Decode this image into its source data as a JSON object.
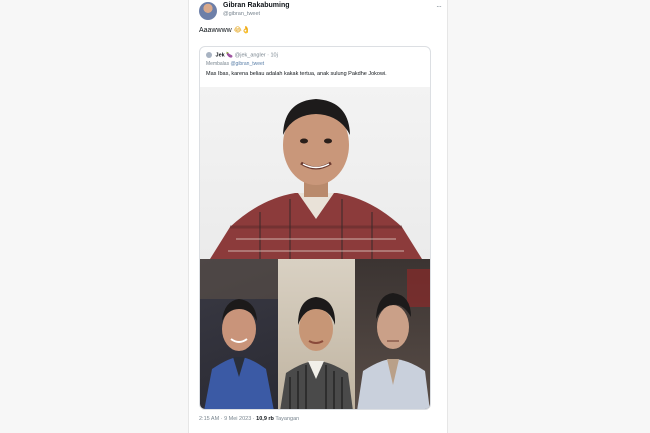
{
  "author": {
    "name": "Gibran Rakabuming",
    "handle": "@gibran_tweet"
  },
  "tweet": {
    "text": "Aaawwww",
    "emojis": "😂👌"
  },
  "quote": {
    "author_name": "Jek",
    "author_emoji": "🍆",
    "handle": "@jek_angler",
    "time": "· 10j",
    "reply_prefix": "Membalas",
    "reply_handle": "@gibran_tweet",
    "text": "Mas Ibas, karena beliau adalah kakak tertua, anak sulung Pakdhe Jokowi."
  },
  "footer": {
    "time_date": "2:15 AM · 9 Mei 2023 ·",
    "views": "10,9 rb",
    "views_label": "Tayangan"
  },
  "icons": {
    "more": "more-options-icon",
    "avatar": "profile-avatar"
  }
}
